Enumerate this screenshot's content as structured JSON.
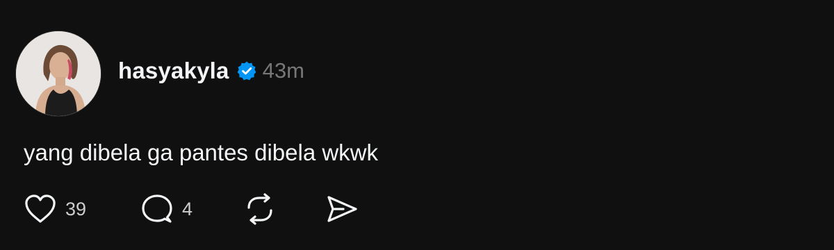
{
  "post": {
    "username": "hasyakyla",
    "time": "43m",
    "text": "yang dibela ga pantes dibela wkwk",
    "likes": "39",
    "replies": "4"
  },
  "colors": {
    "background": "#101010",
    "text": "#f3f5f7",
    "muted": "#777777",
    "verified": "#0095f6"
  },
  "icons": [
    "avatar",
    "verified-badge-icon",
    "heart-icon",
    "comment-icon",
    "repost-icon",
    "share-icon"
  ]
}
